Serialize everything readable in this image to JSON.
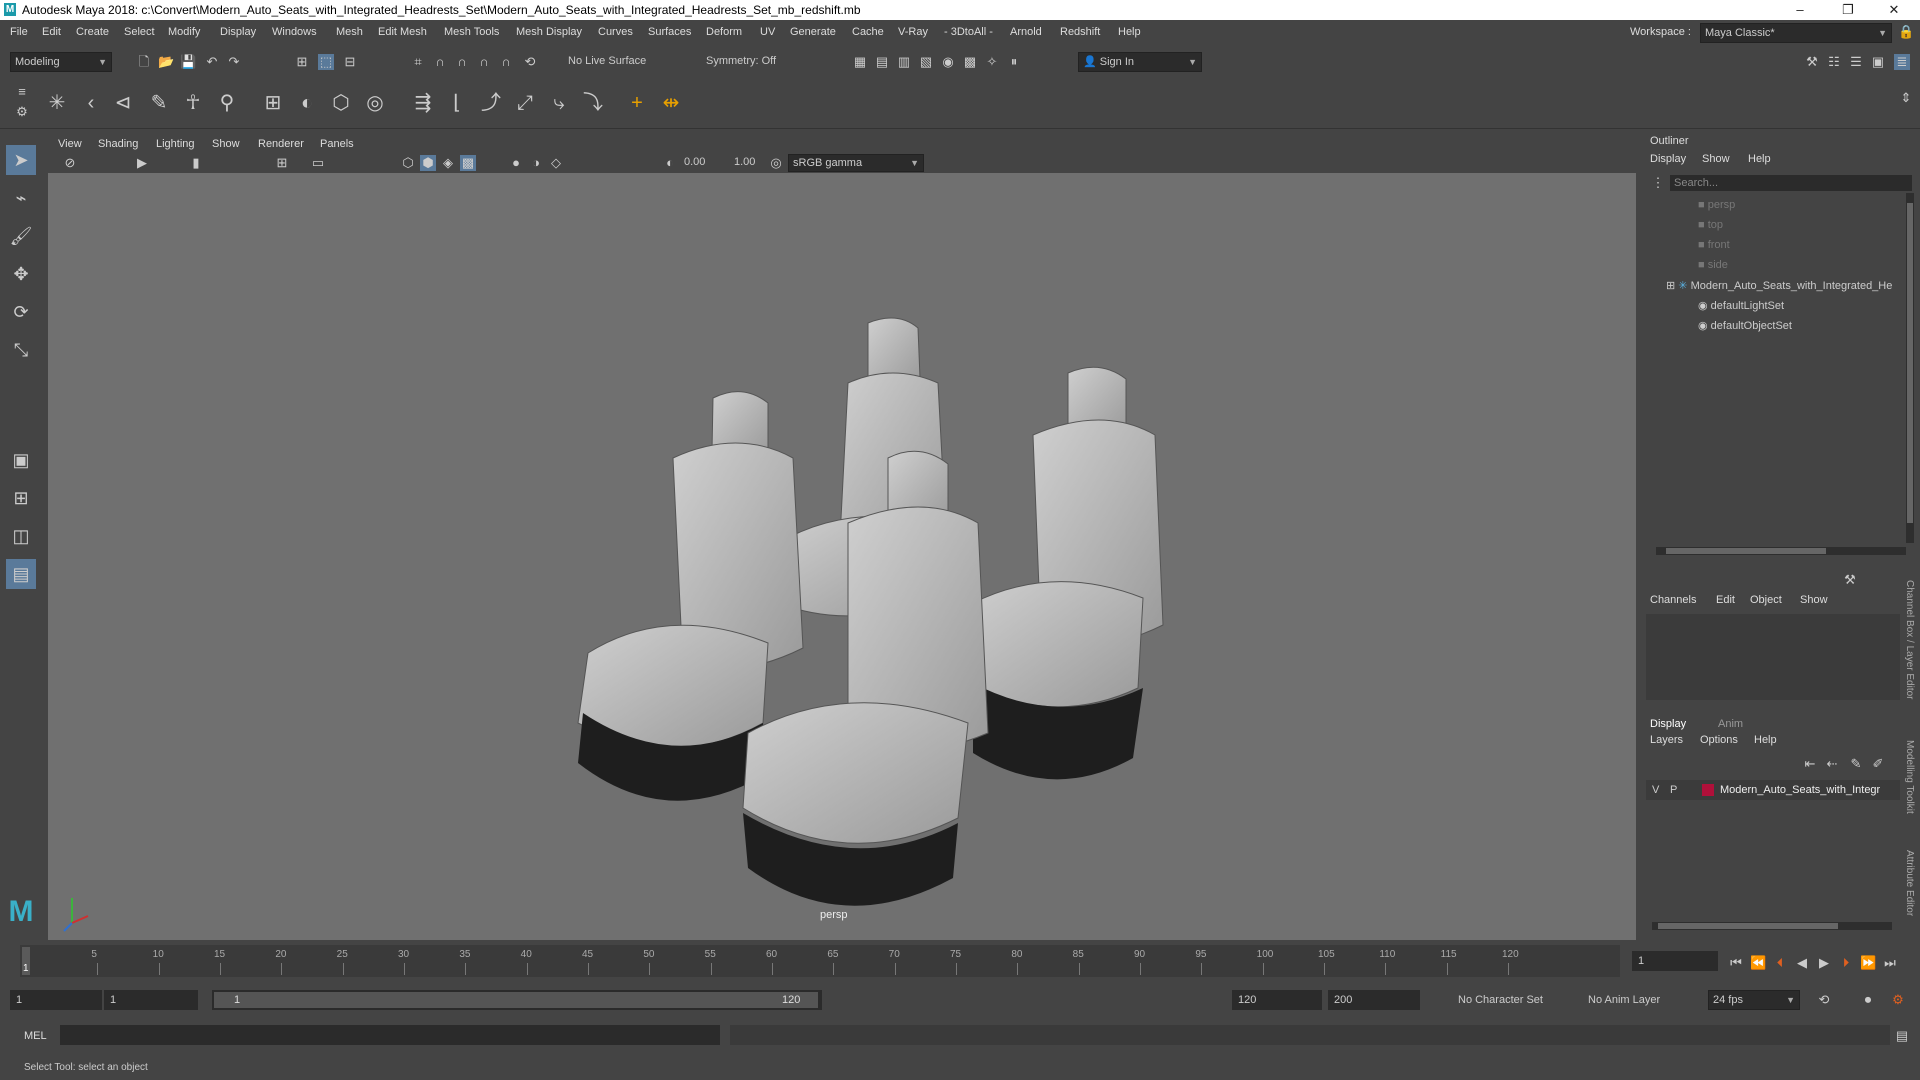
{
  "window": {
    "title": "Autodesk Maya 2018: c:\\Convert\\Modern_Auto_Seats_with_Integrated_Headrests_Set\\Modern_Auto_Seats_with_Integrated_Headrests_Set_mb_redshift.mb",
    "logo": "M",
    "minimize": "–",
    "maximize": "❐",
    "close": "✕"
  },
  "menubar": {
    "items": [
      "File",
      "Edit",
      "Create",
      "Select",
      "Modify",
      "Display",
      "Windows",
      "Mesh",
      "Edit Mesh",
      "Mesh Tools",
      "Mesh Display",
      "Curves",
      "Surfaces",
      "Deform",
      "UV",
      "Generate",
      "Cache",
      "V-Ray",
      "- 3DtoAll -",
      "Arnold",
      "Redshift",
      "Help"
    ],
    "workspace_label": "Workspace :",
    "workspace_value": "Maya Classic*"
  },
  "statusline": {
    "mode": "Modeling",
    "live_surface": "No Live Surface",
    "symmetry": "Symmetry: Off",
    "sign_in": "Sign In"
  },
  "viewport": {
    "menu": [
      "View",
      "Shading",
      "Lighting",
      "Show",
      "Renderer",
      "Panels"
    ],
    "exposure": "0.00",
    "gamma": "1.00",
    "color_space": "sRGB gamma",
    "camera_label": "persp"
  },
  "outliner": {
    "title": "Outliner",
    "menu": [
      "Display",
      "Show",
      "Help"
    ],
    "search_placeholder": "Search...",
    "items": [
      {
        "label": "persp",
        "dim": true
      },
      {
        "label": "top",
        "dim": true
      },
      {
        "label": "front",
        "dim": true
      },
      {
        "label": "side",
        "dim": true
      },
      {
        "label": "Modern_Auto_Seats_with_Integrated_He",
        "dim": false
      },
      {
        "label": "defaultLightSet",
        "dim": false
      },
      {
        "label": "defaultObjectSet",
        "dim": false
      }
    ]
  },
  "channelbox": {
    "menu": [
      "Channels",
      "Edit",
      "Object",
      "Show"
    ]
  },
  "layers": {
    "tabs": [
      "Display",
      "Anim"
    ],
    "menu": [
      "Layers",
      "Options",
      "Help"
    ],
    "layer": {
      "v": "V",
      "p": "P",
      "name": "Modern_Auto_Seats_with_Integr",
      "color": "#b0103a"
    }
  },
  "side_tabs": [
    "Channel Box / Layer Editor",
    "Modelling Toolkit",
    "Attribute Editor"
  ],
  "timeline": {
    "ticks": [
      "5",
      "10",
      "15",
      "20",
      "25",
      "30",
      "35",
      "40",
      "45",
      "50",
      "55",
      "60",
      "65",
      "70",
      "75",
      "80",
      "85",
      "90",
      "95",
      "100",
      "105",
      "110",
      "115",
      "120"
    ],
    "current_frame_marker": "1",
    "current_frame": "1"
  },
  "range": {
    "start": "1",
    "playback_start": "1",
    "slider_start": "1",
    "slider_end": "120",
    "playback_end": "120",
    "end": "200",
    "character_set": "No Character Set",
    "anim_layer": "No Anim Layer",
    "fps": "24 fps"
  },
  "commandline": {
    "label": "MEL"
  },
  "helpline": {
    "text": "Select Tool: select an object"
  }
}
